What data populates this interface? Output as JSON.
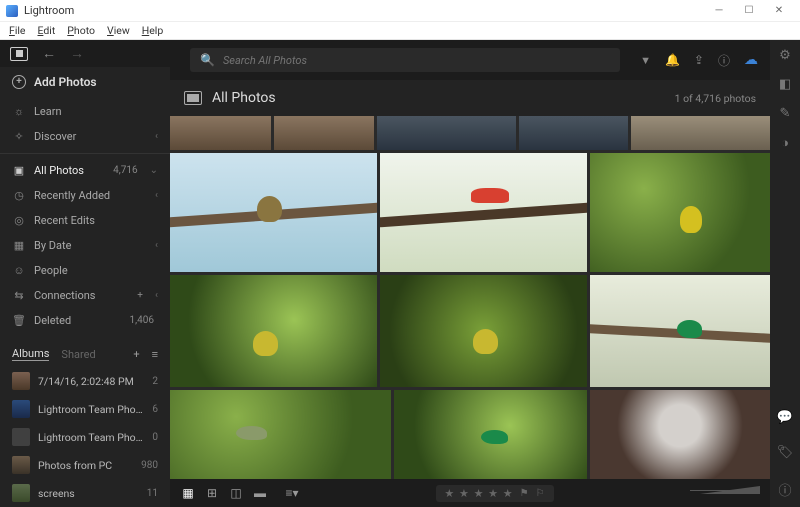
{
  "window": {
    "title": "Lightroom"
  },
  "menubar": [
    "File",
    "Edit",
    "Photo",
    "View",
    "Help"
  ],
  "search": {
    "placeholder": "Search All Photos"
  },
  "sidebar": {
    "add_label": "Add Photos",
    "learn_label": "Learn",
    "discover_label": "Discover",
    "library": [
      {
        "icon": "image",
        "label": "All Photos",
        "count": "4,716",
        "active": true
      },
      {
        "icon": "clock",
        "label": "Recently Added"
      },
      {
        "icon": "edit",
        "label": "Recent Edits"
      },
      {
        "icon": "calendar",
        "label": "By Date"
      },
      {
        "icon": "person",
        "label": "People"
      },
      {
        "icon": "link",
        "label": "Connections",
        "extra": "+"
      },
      {
        "icon": "trash",
        "label": "Deleted",
        "count": "1,406"
      }
    ],
    "tabs": {
      "albums": "Albums",
      "shared": "Shared"
    },
    "albums": [
      {
        "name": "7/14/16, 2:02:48 PM",
        "count": "2"
      },
      {
        "name": "Lightroom Team Photos",
        "count": "6"
      },
      {
        "name": "Lightroom Team Photos",
        "count": "0"
      },
      {
        "name": "Photos from PC",
        "count": "980"
      },
      {
        "name": "screens",
        "count": "11"
      }
    ]
  },
  "main": {
    "title": "All Photos",
    "count_text": "1 of 4,716 photos"
  },
  "footer": {
    "stars": "★ ★ ★ ★ ★"
  }
}
